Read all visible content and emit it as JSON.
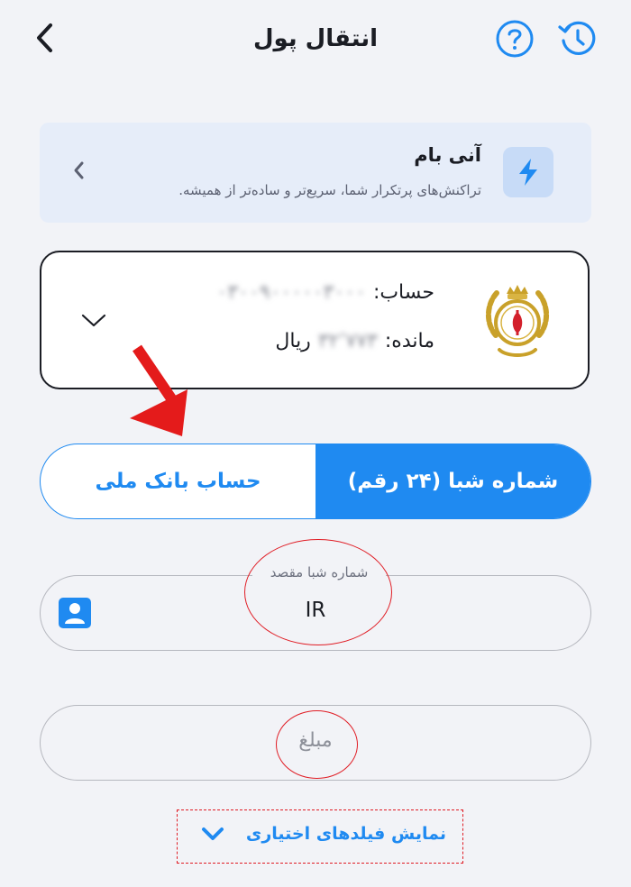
{
  "header": {
    "title": "انتقال پول",
    "back_icon": "chevron-left-icon",
    "help_icon": "question-circle-icon",
    "history_icon": "history-icon"
  },
  "promo": {
    "title": "آنی بام",
    "description": "تراکنش‌های پرتکرار شما، سریع‌تر و ساده‌تر از همیشه.",
    "icon": "lightning-icon"
  },
  "account": {
    "account_label": "حساب:",
    "account_number_masked": "۰۳۰۰۹۰۰۰۰۰۳۰۰۰",
    "balance_label": "مانده:",
    "balance_masked": "۳۲٬۷۷۳",
    "currency": "ریال",
    "bank_logo": "bank-melli-logo"
  },
  "tabs": {
    "active": "شماره شبا (۲۴ رقم)",
    "inactive": "حساب بانک ملی"
  },
  "sheba_field": {
    "label": "شماره شبا مقصد",
    "value": "IR"
  },
  "amount_field": {
    "placeholder": "مبلغ"
  },
  "optional": {
    "label": "نمایش فیلدهای اختیاری"
  },
  "colors": {
    "primary": "#1f8af1",
    "annotation": "#e01c24",
    "background": "#f2f3f7"
  }
}
